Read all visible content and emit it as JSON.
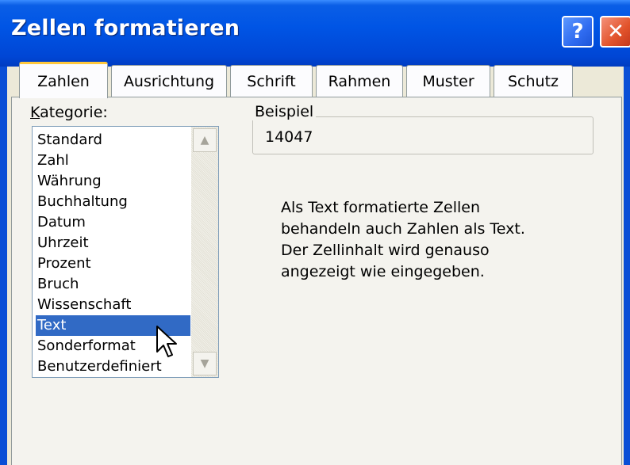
{
  "window": {
    "title": "Zellen formatieren",
    "help_label": "?",
    "close_label": "✕"
  },
  "tabs": [
    {
      "label": "Zahlen",
      "active": true
    },
    {
      "label": "Ausrichtung",
      "active": false
    },
    {
      "label": "Schrift",
      "active": false
    },
    {
      "label": "Rahmen",
      "active": false
    },
    {
      "label": "Muster",
      "active": false
    },
    {
      "label": "Schutz",
      "active": false
    }
  ],
  "category": {
    "label_accel": "K",
    "label_rest": "ategorie:",
    "items": [
      "Standard",
      "Zahl",
      "Währung",
      "Buchhaltung",
      "Datum",
      "Uhrzeit",
      "Prozent",
      "Bruch",
      "Wissenschaft",
      "Text",
      "Sonderformat",
      "Benutzerdefiniert"
    ],
    "selected": "Text"
  },
  "sample": {
    "legend": "Beispiel",
    "value": "14047"
  },
  "description": {
    "lines": [
      "Als Text formatierte Zellen",
      "behandeln auch Zahlen als Text.",
      "Der Zellinhalt wird genauso",
      "angezeigt wie eingegeben."
    ]
  },
  "icons": {
    "scroll_up": "up-arrow-icon",
    "scroll_down": "down-arrow-icon",
    "cursor": "mouse-pointer-icon"
  },
  "colors": {
    "titlebar": "#0055e5",
    "selection": "#316ac5",
    "dialog_bg": "#ece9d8",
    "active_tab_accent": "#ffc83c"
  }
}
